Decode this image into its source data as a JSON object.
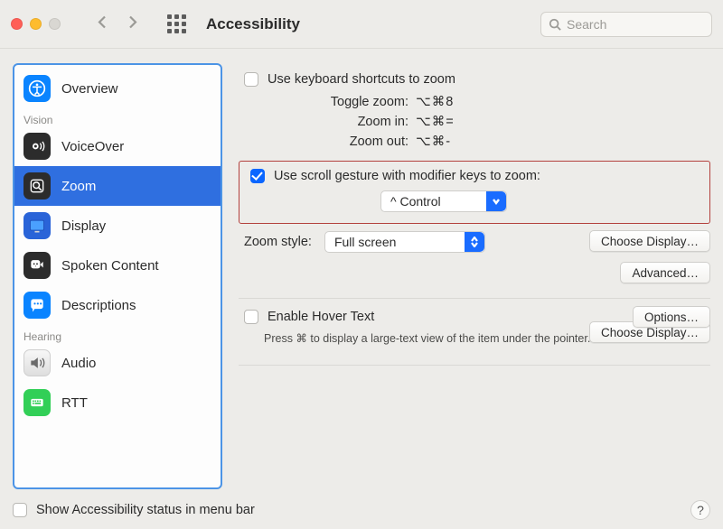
{
  "window": {
    "title": "Accessibility"
  },
  "search": {
    "placeholder": "Search"
  },
  "sidebar": {
    "groups": {
      "vision": "Vision",
      "hearing": "Hearing"
    },
    "items": {
      "overview": "Overview",
      "voiceover": "VoiceOver",
      "zoom": "Zoom",
      "display": "Display",
      "spoken": "Spoken Content",
      "descriptions": "Descriptions",
      "audio": "Audio",
      "rtt": "RTT"
    },
    "selected": "zoom"
  },
  "main": {
    "use_keyboard_shortcuts": {
      "label": "Use keyboard shortcuts to zoom",
      "checked": false
    },
    "shortcut_rows": {
      "toggle": {
        "k": "Toggle zoom:",
        "v": "⌥⌘8"
      },
      "zoomin": {
        "k": "Zoom in:",
        "v": "⌥⌘="
      },
      "zoomout": {
        "k": "Zoom out:",
        "v": "⌥⌘-"
      }
    },
    "scroll_gesture": {
      "label": "Use scroll gesture with modifier keys to zoom:",
      "checked": true,
      "modifier_display": "^ Control"
    },
    "zoom_style": {
      "label": "Zoom style:",
      "value": "Full screen"
    },
    "buttons": {
      "choose_display": "Choose Display…",
      "advanced": "Advanced…",
      "options": "Options…"
    },
    "hover_text": {
      "label": "Enable Hover Text",
      "checked": false,
      "hint": "Press ⌘ to display a large-text view of the item under the pointer."
    },
    "footer": {
      "label": "Show Accessibility status in menu bar",
      "checked": false
    }
  }
}
